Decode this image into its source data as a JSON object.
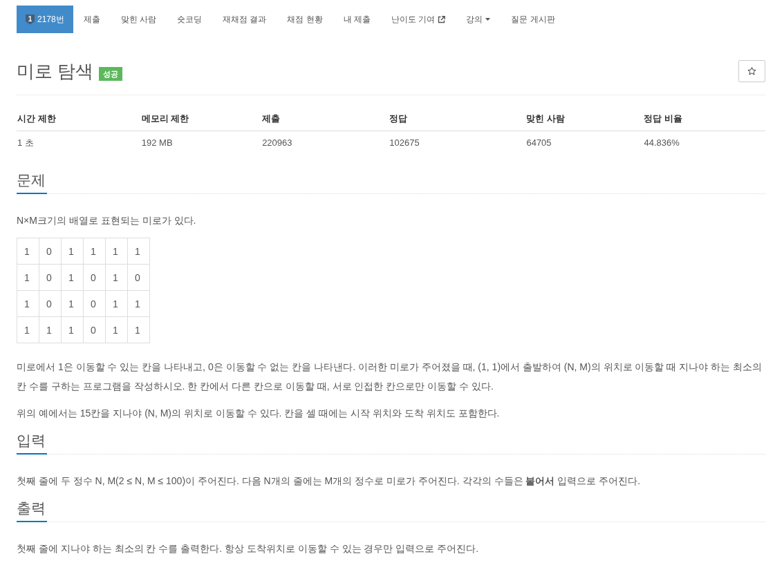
{
  "nav": {
    "tabs": [
      {
        "kind": "problem",
        "tier": "1",
        "label": "2178번",
        "selected": true
      },
      {
        "kind": "link",
        "label": "제출",
        "selected": false
      },
      {
        "kind": "link",
        "label": "맞힌 사람",
        "selected": false
      },
      {
        "kind": "link",
        "label": "숏코딩",
        "selected": false
      },
      {
        "kind": "link",
        "label": "재채점 결과",
        "selected": false
      },
      {
        "kind": "link",
        "label": "채점 현황",
        "selected": false
      },
      {
        "kind": "link",
        "label": "내 제출",
        "selected": false
      },
      {
        "kind": "external",
        "label": "난이도 기여",
        "selected": false
      },
      {
        "kind": "dropdown",
        "label": "강의",
        "selected": false
      },
      {
        "kind": "link",
        "label": "질문 게시판",
        "selected": false
      }
    ]
  },
  "problem": {
    "title": "미로 탐색",
    "status_badge": {
      "label": "성공",
      "kind": "success"
    },
    "starred": false
  },
  "stats": {
    "columns": [
      "시간 제한",
      "메모리 제한",
      "제출",
      "정답",
      "맞힌 사람",
      "정답 비율"
    ],
    "rows": [
      [
        "1 초",
        "192 MB",
        "220963",
        "102675",
        "64705",
        "44.836%"
      ]
    ]
  },
  "sections": [
    {
      "heading": "문제",
      "blocks": [
        {
          "kind": "paragraph",
          "text": "N×M크기의 배열로 표현되는 미로가 있다."
        },
        {
          "kind": "grid",
          "rows": [
            [
              "1",
              "0",
              "1",
              "1",
              "1",
              "1"
            ],
            [
              "1",
              "0",
              "1",
              "0",
              "1",
              "0"
            ],
            [
              "1",
              "0",
              "1",
              "0",
              "1",
              "1"
            ],
            [
              "1",
              "1",
              "1",
              "0",
              "1",
              "1"
            ]
          ]
        },
        {
          "kind": "paragraph",
          "text": "미로에서 1은 이동할 수 있는 칸을 나타내고, 0은 이동할 수 없는 칸을 나타낸다. 이러한 미로가 주어졌을 때, (1, 1)에서 출발하여 (N, M)의 위치로 이동할 때 지나야 하는 최소의 칸 수를 구하는 프로그램을 작성하시오. 한 칸에서 다른 칸으로 이동할 때, 서로 인접한 칸으로만 이동할 수 있다."
        },
        {
          "kind": "paragraph",
          "text": "위의 예에서는 15칸을 지나야 (N, M)의 위치로 이동할 수 있다. 칸을 셀 때에는 시작 위치와 도착 위치도 포함한다."
        }
      ]
    },
    {
      "heading": "입력",
      "blocks": [
        {
          "kind": "paragraph",
          "text": "첫째 줄에 두 정수 N, M(2 ≤ N, M ≤ 100)이 주어진다. 다음 N개의 줄에는 M개의 정수로 미로가 주어진다. 각각의 수들은 **붙어서** 입력으로 주어진다."
        }
      ]
    },
    {
      "heading": "출력",
      "blocks": [
        {
          "kind": "paragraph",
          "text": "첫째 줄에 지나야 하는 최소의 칸 수를 출력한다. 항상 도착위치로 이동할 수 있는 경우만 입력으로 주어진다."
        }
      ]
    }
  ]
}
